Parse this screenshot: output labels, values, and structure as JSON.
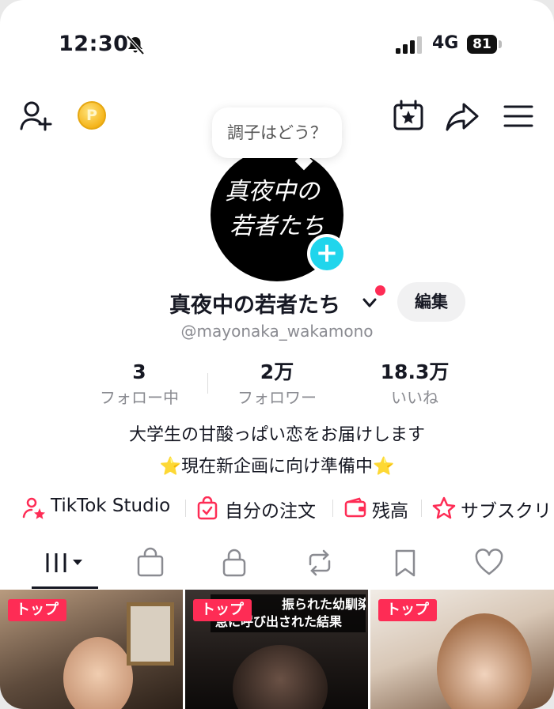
{
  "status_bar": {
    "time": "12:30",
    "network": "4G",
    "battery": "81"
  },
  "top_nav": {
    "coin_label": "P"
  },
  "profile": {
    "bubble": "調子はどう？",
    "avatar_text_line1": "真夜中の",
    "avatar_text_line2": "若者たち",
    "name": "真夜中の若者たち",
    "edit_label": "編集",
    "handle": "@mayonaka_wakamono"
  },
  "stats": [
    {
      "value": "3",
      "label": "フォロー中"
    },
    {
      "value": "2万",
      "label": "フォロワー"
    },
    {
      "value": "18.3万",
      "label": "いいね"
    }
  ],
  "bio": {
    "line1": "大学生の甘酸っぱい恋をお届けします",
    "line2_star_left": "⭐",
    "line2_text": "現在新企画に向け準備中",
    "line2_star_right": "⭐"
  },
  "shortcuts": [
    {
      "label": "TikTok Studio"
    },
    {
      "label": "自分の注文"
    },
    {
      "label": "残高"
    },
    {
      "label": "サブスクリ"
    }
  ],
  "grid": [
    {
      "badge": "トップ",
      "caption": ""
    },
    {
      "badge": "トップ",
      "caption_line1": "振られた幼馴染に",
      "caption_line2": "急に呼び出された結果"
    },
    {
      "badge": "トップ",
      "caption": ""
    }
  ],
  "colors": {
    "accent": "#fe2c55",
    "cyan": "#20d5ec",
    "text": "#161823",
    "muted": "#8a8b91"
  }
}
